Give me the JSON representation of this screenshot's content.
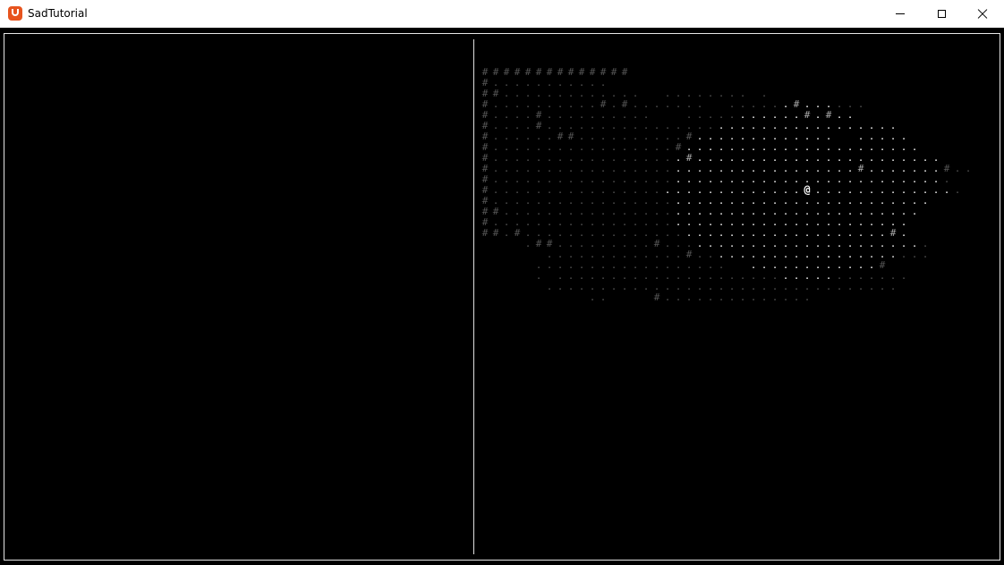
{
  "window": {
    "title": "SadTutorial",
    "icon": "monogame-logo-icon",
    "controls": [
      "minimize-icon",
      "maximize-icon",
      "close-icon"
    ]
  },
  "map": {
    "wall_glyph": "#",
    "floor_glyph": ".",
    "player_glyph": "@",
    "colors": {
      "background": "#000000",
      "lit": "#ffffff",
      "remembered": "#555555",
      "wall_lit": "#aaaaaa"
    },
    "rows": [
      "##############",
      "#...........",
      "##.............  ........ .",
      "#..........#.#.......  ......#......",
      "#....#..........   ...........#.#..",
      "#....#.................................",
      "#......##..........#.............  .....",
      "#.................#......................",
      "#..................#.......................",
      "#..................................#.......#..",
      "#...........................................",
      "#.............................@..............",
      "#.........................................",
      "##.......................................",
      "#.......................................",
      "##.#..................................#.",
      "    .##.........#.........................",
      "      .............#......................",
      "     ..................  ............#",
      "     . .................................",
      "      .................................",
      "          ..    #.............."
    ]
  }
}
